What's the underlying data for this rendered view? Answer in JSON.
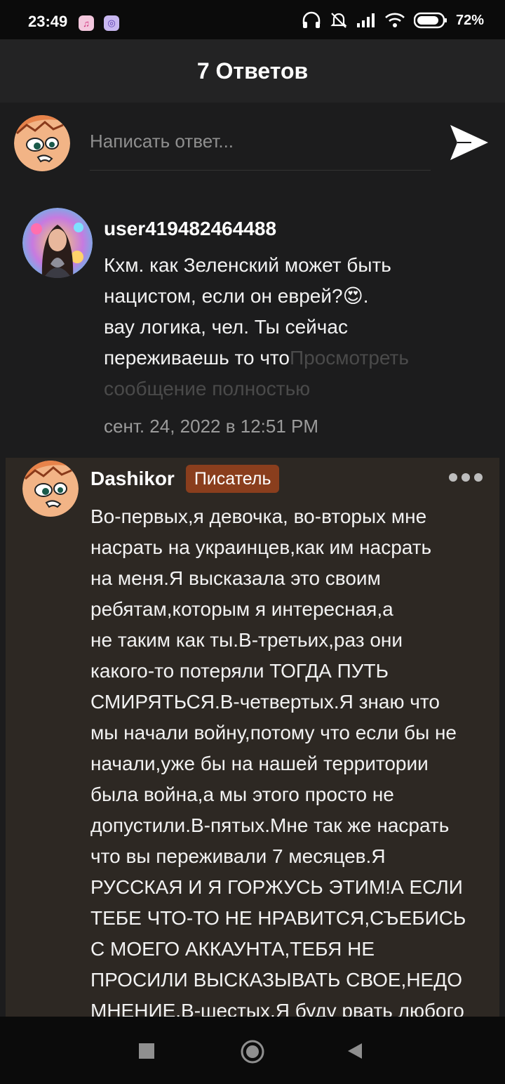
{
  "status_bar": {
    "time": "23:49",
    "battery": "72%"
  },
  "header": {
    "title": "7 Ответов"
  },
  "compose": {
    "placeholder": "Написать ответ..."
  },
  "comments": [
    {
      "username": "user419482464488",
      "text_lines": [
        "Кхм. как Зеленский может быть",
        "нацистом, если он еврей?",
        "вау логика, чел. Ты сейчас",
        "переживаешь то что"
      ],
      "line2_suffix": ".",
      "emoji": "😍",
      "view_full_part1": "Просмотреть",
      "view_full_part2": "сообщение полностью",
      "date": "сент. 24, 2022 в 12:51 PM"
    },
    {
      "username": "Dashikor",
      "badge": "Писатель",
      "text_lines": [
        "Во-первых,я девочка, во-вторых мне",
        "насрать на украинцев,как им насрать",
        "на меня.Я высказала это своим",
        "ребятам,которым я интересная,а",
        "не таким как ты.В-третьих,раз они",
        "какого-то потеряли ТОГДА ПУТЬ",
        "СМИРЯТЬСЯ.В-четвертых.Я знаю что",
        "мы начали войну,потому что если бы не",
        "начали,уже бы на нашей территории",
        "была война,а мы этого просто не",
        "допустили.В-пятых.Мне так же насрать",
        "что вы переживали 7 месяцев.Я",
        "РУССКАЯ И Я ГОРЖУСЬ ЭТИМ!А ЕСЛИ",
        "ТЕБЕ ЧТО-ТО НЕ НРАВИТСЯ,СЪЕБИСЬ",
        "С МОЕГО АККАУНТА,ТЕБЯ НЕ",
        "ПРОСИЛИ ВЫСКАЗЫВАТЬ СВОЕ,НЕДО",
        "МНЕНИЕ.В-шестых.Я буду рвать любого"
      ]
    }
  ],
  "icons": {
    "status_app_1": "music-app-icon",
    "status_app_2": "app-icon",
    "headphones": "headphones-icon",
    "mute": "bell-off-icon",
    "signal": "signal-icon",
    "wifi": "wifi-icon",
    "battery": "battery-icon",
    "send": "send-icon",
    "more": "more-dots-icon",
    "nav_recents": "square-icon",
    "nav_home": "circle-icon",
    "nav_back": "triangle-back-icon"
  },
  "colors": {
    "background": "#1c1c1d",
    "header": "#232324",
    "highlight_comment": "#2d2823",
    "badge": "#8a3e1d"
  }
}
